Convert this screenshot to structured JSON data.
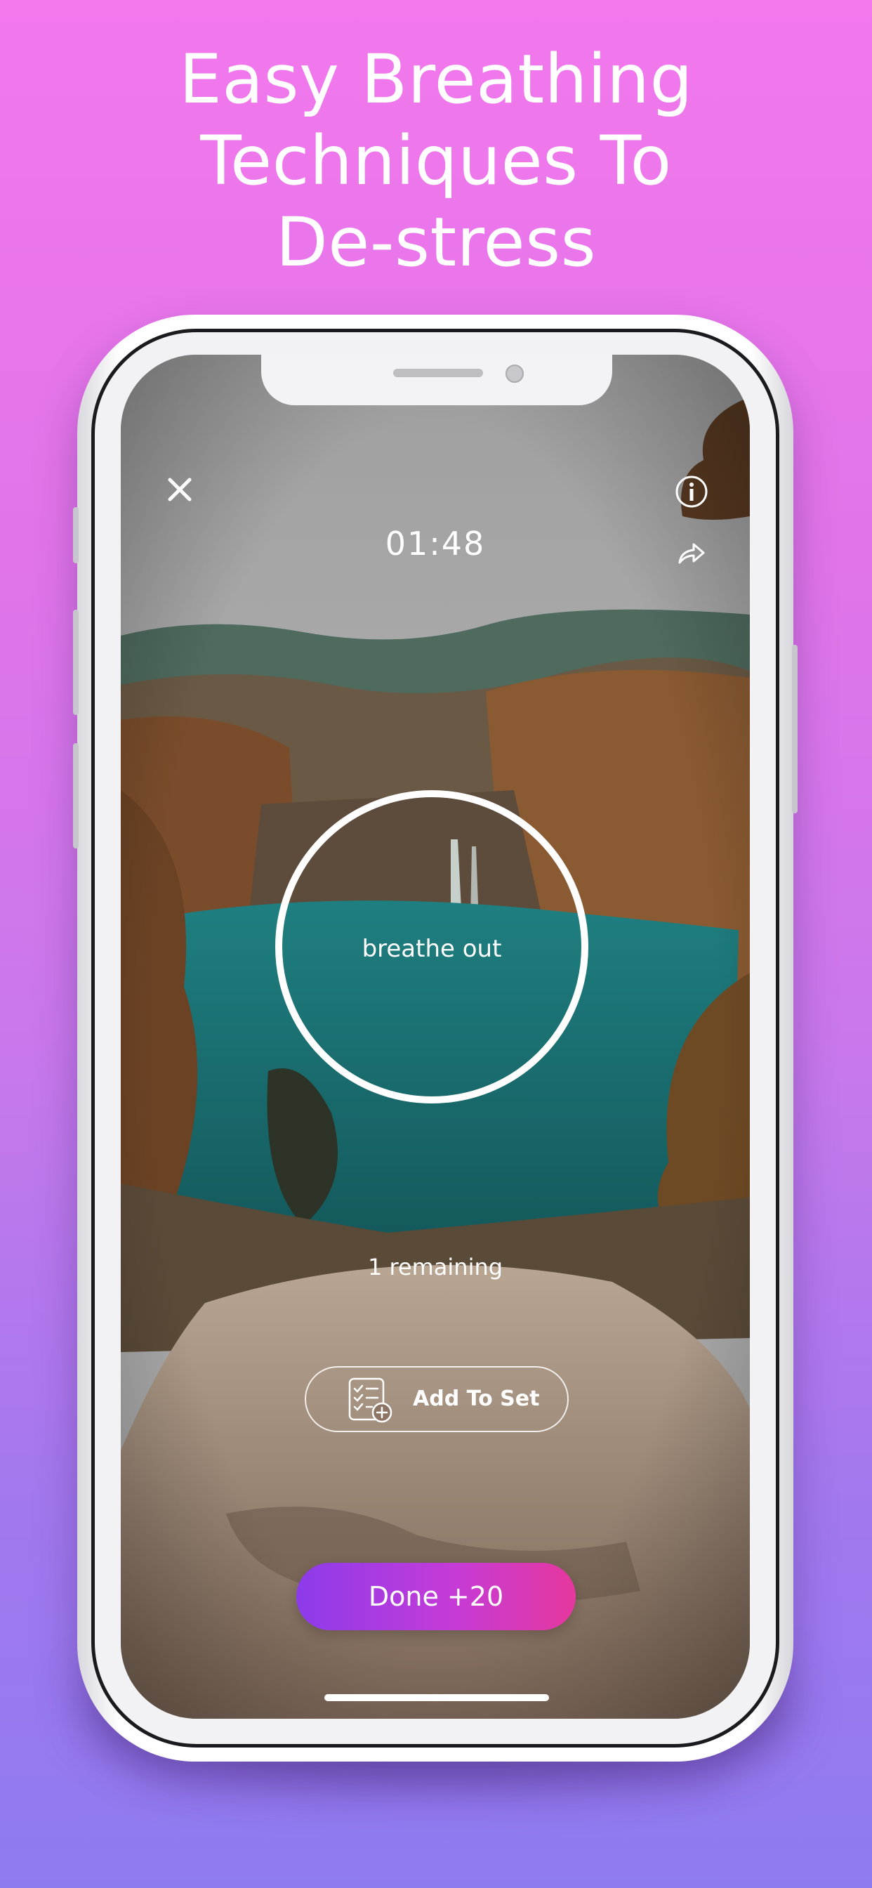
{
  "headline": {
    "line1": "Easy Breathing",
    "line2": "Techniques To",
    "line3": "De-stress"
  },
  "session": {
    "timer": "01:48",
    "instruction": "breathe out",
    "remaining": "1 remaining"
  },
  "icons": {
    "close": "close-icon",
    "info": "info-icon",
    "share": "share-icon",
    "add_to_set": "checklist-add-icon"
  },
  "buttons": {
    "add_to_set": "Add To Set",
    "done": "Done +20"
  },
  "colors": {
    "background_top": "#f278ec",
    "background_bottom": "#8f7bf0",
    "done_gradient_start": "#8c3bea",
    "done_gradient_end": "#e6389e",
    "text": "#ffffff"
  }
}
